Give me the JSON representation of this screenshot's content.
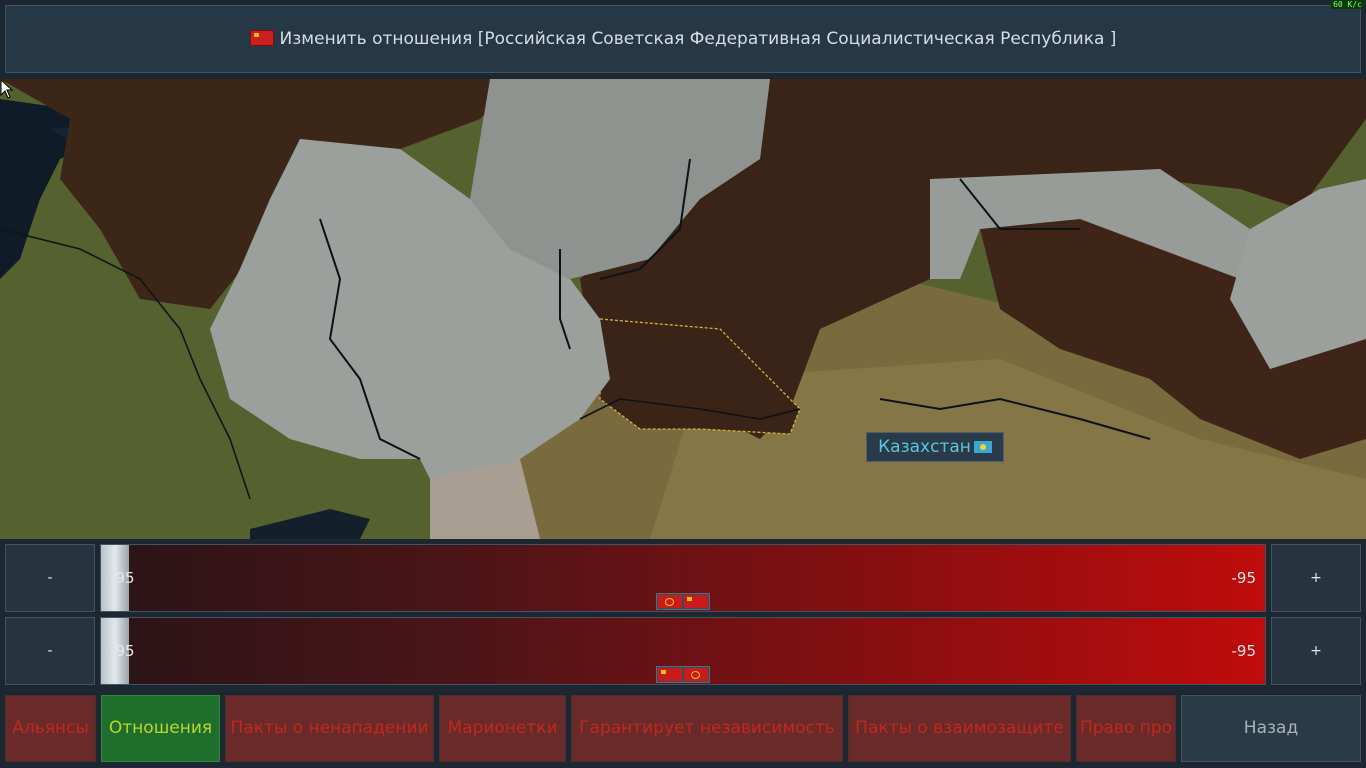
{
  "header": {
    "title": "Изменить отношения [Российская Советская Федеративная Социалистическая Республика ]",
    "fps": "60 K/c"
  },
  "map": {
    "tooltip_country": "Казахстан",
    "colors": {
      "soviet_territory": "#3a2418",
      "neutral_grey": "#9aa09e",
      "steppe": "#7a6e40",
      "forest": "#4a5a2a",
      "water": "#0e1a26"
    }
  },
  "relations": [
    {
      "minus_label": "-",
      "plus_label": "+",
      "left_value": "-95",
      "right_value": "-95",
      "level": -95
    },
    {
      "minus_label": "-",
      "plus_label": "+",
      "left_value": "-95",
      "right_value": "-95",
      "level": -95
    }
  ],
  "tabs": [
    {
      "label": "Альянсы",
      "active": false
    },
    {
      "label": "Отношения",
      "active": true
    },
    {
      "label": "Пакты о ненападении",
      "active": false
    },
    {
      "label": "Марионетки",
      "active": false
    },
    {
      "label": "Гарантирует независимость",
      "active": false
    },
    {
      "label": "Пакты о взаимозащите",
      "active": false
    },
    {
      "label": "Право про",
      "active": false
    }
  ],
  "back_label": "Назад"
}
